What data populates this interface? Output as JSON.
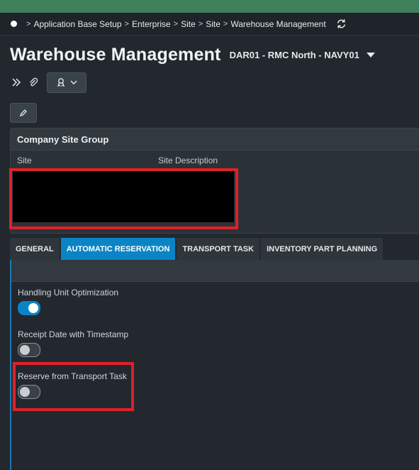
{
  "breadcrumb": {
    "items": [
      "Application Base Setup",
      "Enterprise",
      "Site",
      "Site",
      "Warehouse Management"
    ]
  },
  "page": {
    "title": "Warehouse Management",
    "context": "DAR01 - RMC North - NAVY01"
  },
  "group": {
    "title": "Company Site Group",
    "col_site": "Site",
    "col_description": "Site Description"
  },
  "tabs": [
    {
      "label": "GENERAL",
      "active": false
    },
    {
      "label": "AUTOMATIC RESERVATION",
      "active": true
    },
    {
      "label": "TRANSPORT TASK",
      "active": false
    },
    {
      "label": "INVENTORY PART PLANNING",
      "active": false
    }
  ],
  "fields": [
    {
      "label": "Handling Unit Optimization",
      "on": true
    },
    {
      "label": "Receipt Date with Timestamp",
      "on": false
    },
    {
      "label": "Reserve from Transport Task",
      "on": false
    }
  ],
  "colors": {
    "accent": "#0b84c6",
    "highlight": "#e0202a",
    "topbar": "#3f7f5c"
  }
}
